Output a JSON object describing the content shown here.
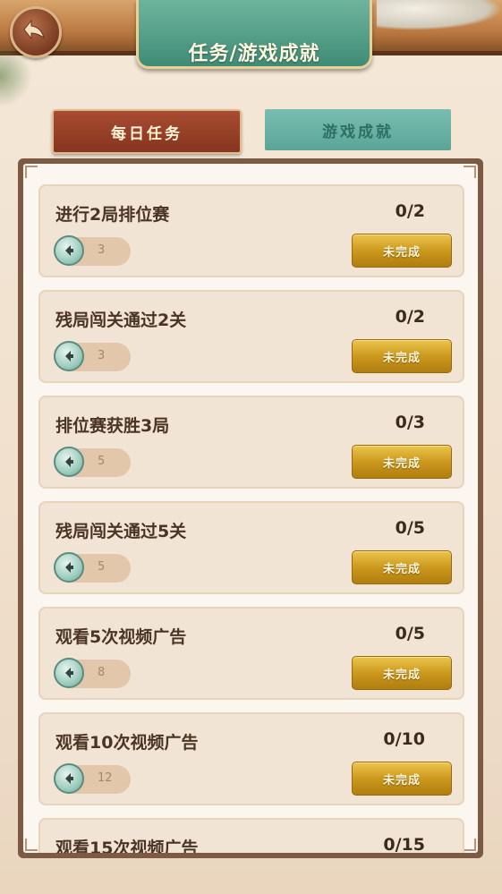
{
  "header": {
    "title": "任务/游戏成就"
  },
  "tabs": [
    {
      "label": "每日任务",
      "active": true
    },
    {
      "label": "游戏成就",
      "active": false
    }
  ],
  "tasks": [
    {
      "name": "进行2局排位赛",
      "progress": "0/2",
      "reward": "3",
      "status": "未完成"
    },
    {
      "name": "残局闯关通过2关",
      "progress": "0/2",
      "reward": "3",
      "status": "未完成"
    },
    {
      "name": "排位赛获胜3局",
      "progress": "0/3",
      "reward": "5",
      "status": "未完成"
    },
    {
      "name": "残局闯关通过5关",
      "progress": "0/5",
      "reward": "5",
      "status": "未完成"
    },
    {
      "name": "观看5次视频广告",
      "progress": "0/5",
      "reward": "8",
      "status": "未完成"
    },
    {
      "name": "观看10次视频广告",
      "progress": "0/10",
      "reward": "12",
      "status": "未完成"
    },
    {
      "name": "观看15次视频广告",
      "progress": "0/15",
      "reward": "",
      "status": ""
    }
  ],
  "colors": {
    "active_tab": "#8f3b24",
    "inactive_tab": "#6ab3a6",
    "status_button": "#d4a327",
    "title_banner": "#4f9a84"
  },
  "icons": {
    "back": "back-arrow-icon",
    "reward": "coin-icon"
  }
}
